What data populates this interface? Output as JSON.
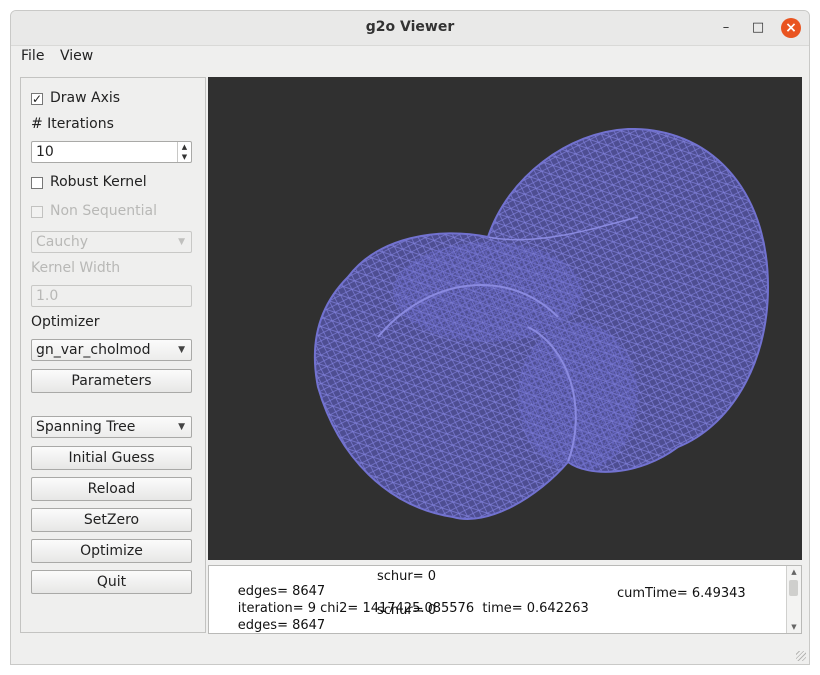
{
  "window": {
    "title": "g2o Viewer",
    "controls": {
      "minimize": "–",
      "maximize": "□",
      "close": "×"
    }
  },
  "menu": {
    "file": "File",
    "view": "View"
  },
  "panel": {
    "draw_axis": {
      "label": "Draw Axis",
      "checked": true,
      "mark": "✓"
    },
    "iterations_label": "# Iterations",
    "iterations_value": "10",
    "robust_kernel": {
      "label": "Robust Kernel",
      "checked": false
    },
    "non_sequential": {
      "label": "Non Sequential",
      "checked": false
    },
    "kernel_select": "Cauchy",
    "kernel_width_label": "Kernel Width",
    "kernel_width_value": "1.0",
    "optimizer_label": "Optimizer",
    "optimizer_select": "gn_var_cholmod",
    "parameters_button": "Parameters",
    "initial_select": "Spanning Tree",
    "initial_guess_button": "Initial Guess",
    "reload_button": "Reload",
    "setzero_button": "SetZero",
    "optimize_button": "Optimize",
    "quit_button": "Quit"
  },
  "icons": {
    "dropdown": "chevron-down-icon",
    "spin_up": "arrow-up-icon",
    "spin_down": "arrow-down-icon"
  },
  "colors": {
    "mesh": "#6a6ac8",
    "viewer_bg": "#303030",
    "close": "#e95420"
  },
  "log": {
    "lines": [
      {
        "a": "edges= 8647",
        "b": "schur= 0",
        "c": ""
      },
      {
        "a": "iteration= 9 chi2= 1417425.085576  time= 0.642263",
        "b": "",
        "c": "cumTime= 6.49343"
      },
      {
        "a": "edges= 8647",
        "b": "schur= 0",
        "c": ""
      }
    ]
  }
}
